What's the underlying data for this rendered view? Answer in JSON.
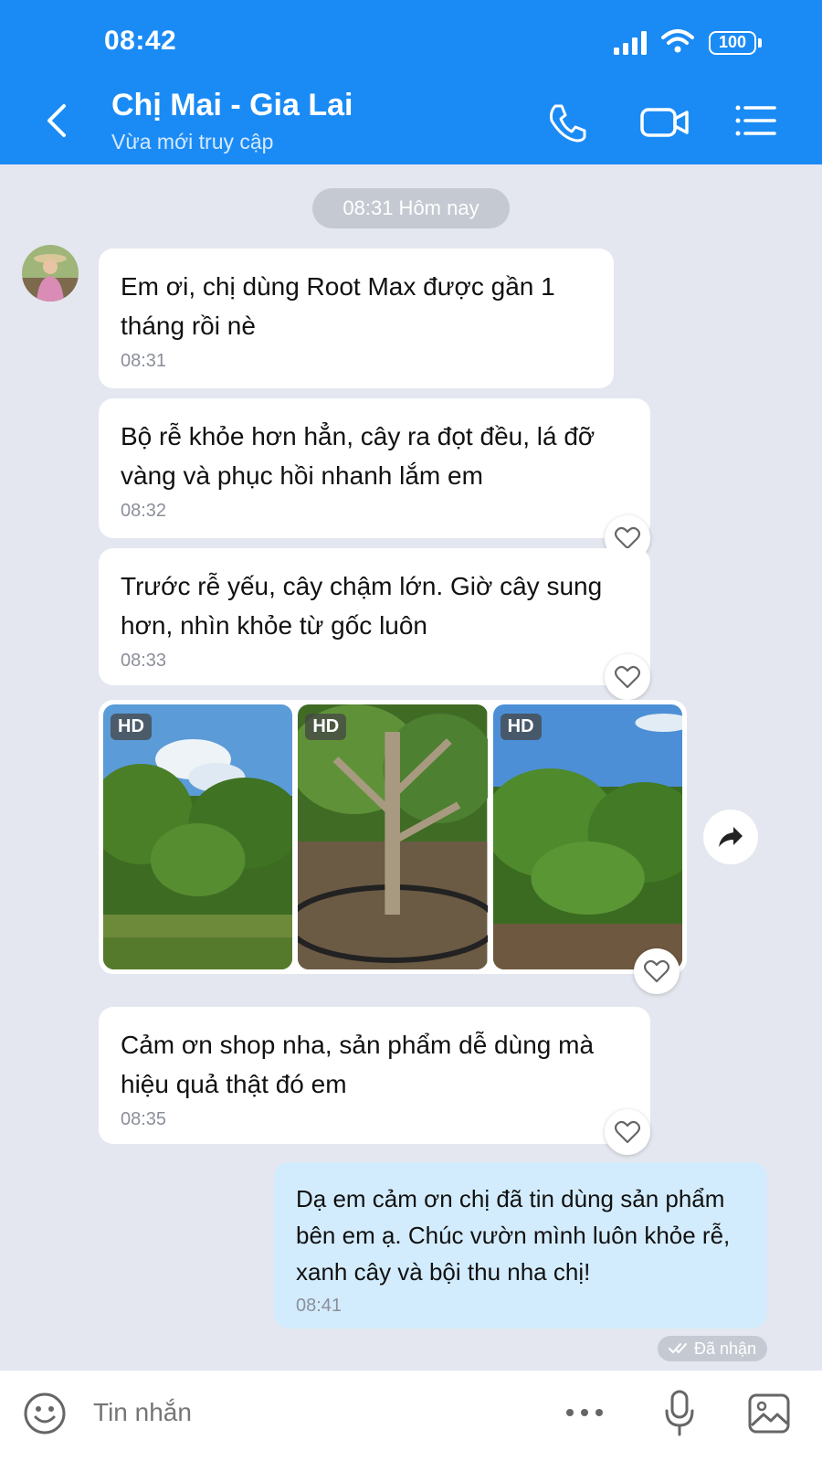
{
  "status_bar": {
    "time": "08:42",
    "battery": "100"
  },
  "header": {
    "name": "Chị Mai - Gia Lai",
    "status": "Vừa mới truy cập"
  },
  "date_divider": "08:31 Hôm nay",
  "messages": [
    {
      "text": "Em ơi, chị dùng Root Max được gần 1 tháng rồi nè",
      "time": "08:31"
    },
    {
      "text": "Bộ rễ khỏe hơn hẳn, cây ra đọt đều, lá đỡ vàng và phục hồi nhanh lắm em",
      "time": "08:32"
    },
    {
      "text": "Trước rễ yếu, cây chậm lớn. Giờ cây sung hơn, nhìn khỏe từ gốc luôn",
      "time": "08:33"
    },
    {
      "text": "Cảm ơn shop nha, sản phẩm dễ dùng mà hiệu quả thật đó em",
      "time": "08:35"
    }
  ],
  "photos": {
    "badges": [
      "HD",
      "HD",
      "HD"
    ]
  },
  "reply": {
    "text": "Dạ em cảm ơn chị đã tin dùng sản phẩm bên em ạ. Chúc vườn mình luôn khỏe rễ, xanh cây và bội thu nha chị!",
    "time": "08:41"
  },
  "delivery_status": "Đã nhận",
  "input": {
    "placeholder": "Tin nhắn"
  },
  "icons": [
    "back-arrow-icon",
    "phone-icon",
    "video-camera-icon",
    "menu-icon",
    "heart-icon",
    "share-arrow-icon",
    "emoji-icon",
    "more-dots-icon",
    "microphone-icon",
    "image-icon",
    "double-check-icon"
  ],
  "colors": {
    "header": "#1a8bf5",
    "background": "#e4e7ef",
    "my_bubble": "#d3ecfd"
  }
}
